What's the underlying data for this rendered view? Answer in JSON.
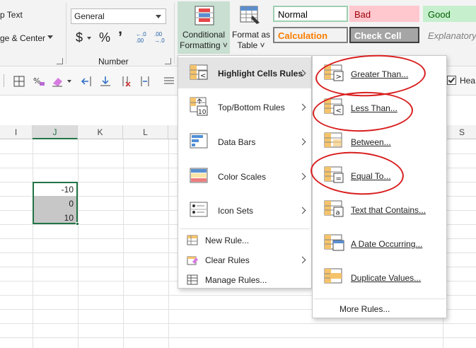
{
  "ribbon": {
    "wrap_text": "p Text",
    "merge_center": "ge & Center",
    "number_format": "General",
    "currency": "$",
    "percent": "%",
    "comma": "’",
    "inc_decimal": "←.0 .00",
    "dec_decimal": ".00 →.0",
    "number_group": "Number",
    "conditional_formatting_line1": "Conditional",
    "conditional_formatting_line2": "Formatting ˅",
    "format_as_table_line1": "Format as",
    "format_as_table_line2": "Table ˅",
    "styles": [
      {
        "label": "Normal",
        "bg": "#ffffff",
        "fg": "#000000",
        "border": "#9ecfb0"
      },
      {
        "label": "Bad",
        "bg": "#ffc7ce",
        "fg": "#9c0006",
        "border": "#ffc7ce"
      },
      {
        "label": "Good",
        "bg": "#c6efce",
        "fg": "#006100",
        "border": "#c6efce"
      },
      {
        "label": "Calculation",
        "bg": "#f2f2f2",
        "fg": "#fa7d00",
        "border": "#7f7f7f"
      },
      {
        "label": "Check Cell",
        "bg": "#a5a5a5",
        "fg": "#ffffff",
        "border": "#3f3f3f"
      },
      {
        "label": "Explanatory",
        "bg": "#f3f3f3",
        "fg": "#7f7f7f",
        "border": "#f3f3f3"
      }
    ]
  },
  "toolbar": {
    "headers_label": "Hea"
  },
  "grid": {
    "columns": [
      "I",
      "J",
      "K",
      "L",
      "S"
    ],
    "selected_values": [
      "-10",
      "0",
      "10"
    ]
  },
  "cf_menu": {
    "items": [
      {
        "label": "Highlight Cells Rules",
        "has_submenu": true
      },
      {
        "label": "Top/Bottom Rules",
        "has_submenu": true
      },
      {
        "label": "Data Bars",
        "has_submenu": true
      },
      {
        "label": "Color Scales",
        "has_submenu": true
      },
      {
        "label": "Icon Sets",
        "has_submenu": true
      }
    ],
    "small_items": [
      {
        "label": "New Rule...",
        "has_submenu": false
      },
      {
        "label": "Clear Rules",
        "has_submenu": true
      },
      {
        "label": "Manage Rules...",
        "has_submenu": false
      }
    ]
  },
  "highlight_submenu": {
    "items": [
      {
        "label": "Greater Than...",
        "glyph": ">"
      },
      {
        "label": "Less Than...",
        "glyph": "<"
      },
      {
        "label": "Between...",
        "glyph": ""
      },
      {
        "label": "Equal To...",
        "glyph": "="
      },
      {
        "label": "Text that Contains...",
        "glyph": "a"
      },
      {
        "label": "A Date Occurring...",
        "glyph": ""
      },
      {
        "label": "Duplicate Values...",
        "glyph": ""
      }
    ],
    "more_rules": "More Rules..."
  },
  "colors": {
    "accent_green": "#217346",
    "hover_green": "#c8dfd1",
    "annotation_red": "#d81e1e"
  }
}
